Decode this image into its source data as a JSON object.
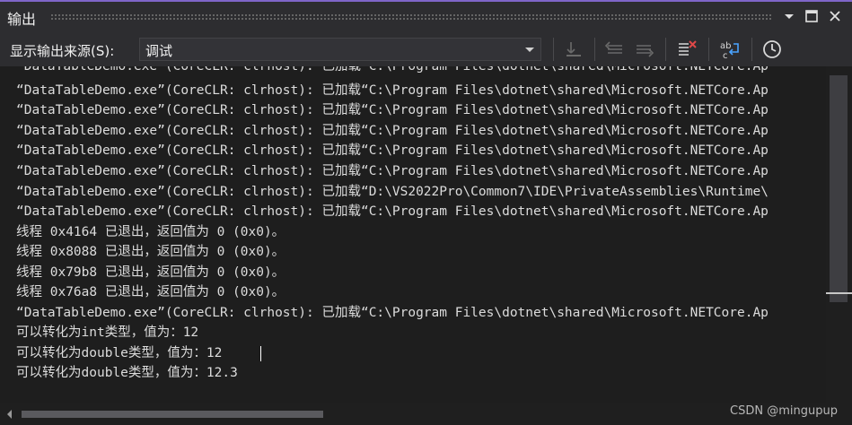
{
  "panel": {
    "title": "输出"
  },
  "toolbar": {
    "source_label": "显示输出来源(S):",
    "source_value": "调试"
  },
  "output_lines": [
    "“DataTableDemo.exe”(CoreCLR: clrhost): 已加载“C:\\Program Files\\dotnet\\shared\\Microsoft.NETCore.Ap",
    "“DataTableDemo.exe”(CoreCLR: clrhost): 已加载“C:\\Program Files\\dotnet\\shared\\Microsoft.NETCore.Ap",
    "“DataTableDemo.exe”(CoreCLR: clrhost): 已加载“C:\\Program Files\\dotnet\\shared\\Microsoft.NETCore.Ap",
    "“DataTableDemo.exe”(CoreCLR: clrhost): 已加载“C:\\Program Files\\dotnet\\shared\\Microsoft.NETCore.Ap",
    "“DataTableDemo.exe”(CoreCLR: clrhost): 已加载“C:\\Program Files\\dotnet\\shared\\Microsoft.NETCore.Ap",
    "“DataTableDemo.exe”(CoreCLR: clrhost): 已加载“C:\\Program Files\\dotnet\\shared\\Microsoft.NETCore.Ap",
    "“DataTableDemo.exe”(CoreCLR: clrhost): 已加载“D:\\VS2022Pro\\Common7\\IDE\\PrivateAssemblies\\Runtime\\",
    "“DataTableDemo.exe”(CoreCLR: clrhost): 已加载“C:\\Program Files\\dotnet\\shared\\Microsoft.NETCore.Ap",
    "线程 0x4164 已退出，返回值为 0 (0x0)。",
    "线程 0x8088 已退出，返回值为 0 (0x0)。",
    "线程 0x79b8 已退出，返回值为 0 (0x0)。",
    "线程 0x76a8 已退出，返回值为 0 (0x0)。",
    "“DataTableDemo.exe”(CoreCLR: clrhost): 已加载“C:\\Program Files\\dotnet\\shared\\Microsoft.NETCore.Ap",
    "可以转化为int类型，值为：12",
    "可以转化为double类型，值为：12",
    "可以转化为double类型，值为：12.3"
  ],
  "watermark": "CSDN @mingupup",
  "colors": {
    "accent": "#7f66c9",
    "background": "#1e1e1e",
    "text": "#dcdcdc"
  }
}
